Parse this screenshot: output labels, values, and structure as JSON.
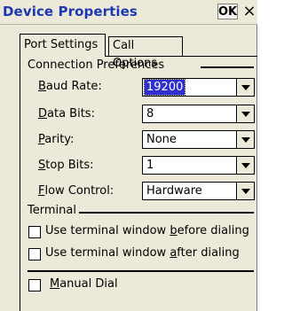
{
  "window": {
    "title": "Device Properties",
    "ok_label": "OK",
    "close_glyph": "×"
  },
  "tabs": [
    {
      "label": "Port Settings",
      "active": true
    },
    {
      "label": "Call Options",
      "active": false
    }
  ],
  "connection_preferences": {
    "heading": "Connection Preferences",
    "fields": [
      {
        "mnemonic": "B",
        "rest": "aud Rate:",
        "value": "19200",
        "selected": true
      },
      {
        "mnemonic": "D",
        "rest": "ata Bits:",
        "value": "8",
        "selected": false
      },
      {
        "mnemonic": "P",
        "rest": "arity:",
        "value": "None",
        "selected": false
      },
      {
        "mnemonic": "S",
        "rest": "top Bits:",
        "value": "1",
        "selected": false
      },
      {
        "mnemonic": "F",
        "rest": "low Control:",
        "value": "Hardware",
        "selected": false
      }
    ]
  },
  "terminal": {
    "heading": "Terminal",
    "options": [
      {
        "before": "Use terminal window ",
        "mnemonic": "b",
        "after": "efore dialing",
        "checked": false
      },
      {
        "before": "Use terminal window ",
        "mnemonic": "a",
        "after": "fter dialing",
        "checked": false
      }
    ]
  },
  "manual_dial": {
    "mnemonic": "M",
    "rest": "anual Dial",
    "checked": false
  }
}
